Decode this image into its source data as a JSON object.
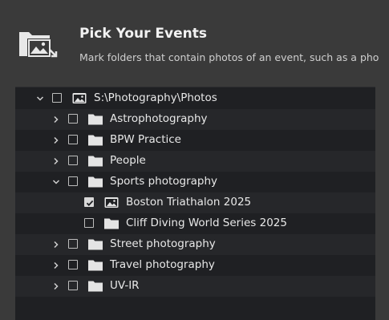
{
  "header": {
    "title": "Pick Your Events",
    "subtitle": "Mark folders that contain photos of an event, such as a pho",
    "icon": "photo-folder-import-icon"
  },
  "tree": {
    "rows": [
      {
        "label": "S:\\Photography\\Photos",
        "level": 0,
        "expander": "expanded",
        "checked": false,
        "icon": "image-icon"
      },
      {
        "label": "Astrophotography",
        "level": 1,
        "expander": "collapsed",
        "checked": false,
        "icon": "folder-icon"
      },
      {
        "label": "BPW Practice",
        "level": 1,
        "expander": "collapsed",
        "checked": false,
        "icon": "folder-icon"
      },
      {
        "label": "People",
        "level": 1,
        "expander": "collapsed",
        "checked": false,
        "icon": "folder-icon"
      },
      {
        "label": "Sports photography",
        "level": 1,
        "expander": "expanded",
        "checked": false,
        "icon": "folder-icon"
      },
      {
        "label": "Boston Triathalon 2025",
        "level": 2,
        "expander": "none",
        "checked": true,
        "icon": "image-icon"
      },
      {
        "label": "Cliff Diving World Series 2025",
        "level": 2,
        "expander": "none",
        "checked": false,
        "icon": "folder-icon"
      },
      {
        "label": "Street photography",
        "level": 1,
        "expander": "collapsed",
        "checked": false,
        "icon": "folder-icon"
      },
      {
        "label": "Travel photography",
        "level": 1,
        "expander": "collapsed",
        "checked": false,
        "icon": "folder-icon"
      },
      {
        "label": "UV-IR",
        "level": 1,
        "expander": "collapsed",
        "checked": false,
        "icon": "folder-icon"
      }
    ]
  }
}
